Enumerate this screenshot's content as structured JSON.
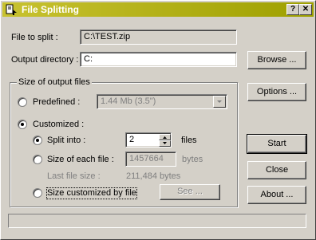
{
  "window": {
    "title": "File Splitting",
    "help_glyph": "?",
    "close_glyph": "✕"
  },
  "file_to_split": {
    "label": "File to split :",
    "value": "C:\\TEST.zip"
  },
  "output_directory": {
    "label": "Output directory :",
    "value": "C:"
  },
  "size_group": {
    "legend": "Size of output files",
    "predefined": {
      "label": "Predefined :",
      "value": "1.44 Mb (3.5\")",
      "selected": false
    },
    "customized": {
      "label": "Customized :",
      "selected": true
    },
    "split_into": {
      "label": "Split into :",
      "value": "2",
      "unit": "files",
      "selected": true
    },
    "size_each": {
      "label": "Size of each file :",
      "value": "1457664",
      "unit": "bytes",
      "selected": false
    },
    "last_file": {
      "label": "Last file size :",
      "value": "211,484 bytes"
    },
    "size_custom": {
      "label": "Size customized by file",
      "selected": false,
      "see_label": "See ..."
    }
  },
  "buttons": {
    "browse": "Browse ...",
    "options": "Options ...",
    "start": "Start",
    "close": "Close",
    "about": "About ..."
  },
  "icons": {
    "app": "file-split-icon",
    "dropdown": "chevron-down-icon",
    "spin_up": "arrow-up-icon",
    "spin_down": "arrow-down-icon"
  },
  "colors": {
    "title_start": "#c8c230",
    "title_end": "#9ea000"
  }
}
